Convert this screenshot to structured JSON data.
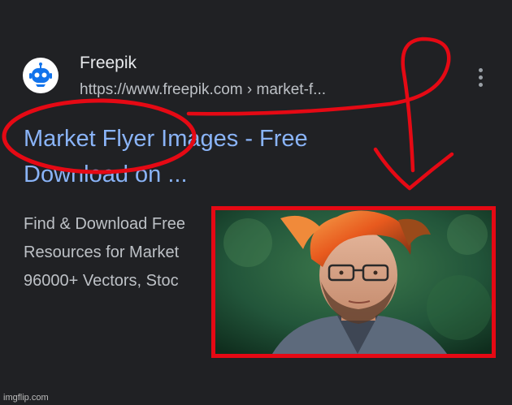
{
  "result": {
    "favicon_icon": "freepik-robot-icon",
    "site_name": "Freepik",
    "url": "https://www.freepik.com › market-f...",
    "more_icon": "more-vert-icon",
    "title_line1": "Market Flyer Images - Free",
    "title_line2": "Download on ...",
    "snippet_lines": [
      "Find & Download Free",
      "Resources for Market",
      "96000+ Vectors, Stoc"
    ]
  },
  "overlay": {
    "photo_subject": "man-with-orange-hair-and-glasses-photo",
    "border_color": "#e50914",
    "annotation_color": "#e50914",
    "annotation_shapes": [
      "circle-around-market-flyer",
      "curved-arrow-down"
    ]
  },
  "colors": {
    "background": "#202124",
    "title": "#8ab4f8",
    "text": "#bdc1c6",
    "site_name": "#e8eaed"
  },
  "watermark": "imgflip.com"
}
